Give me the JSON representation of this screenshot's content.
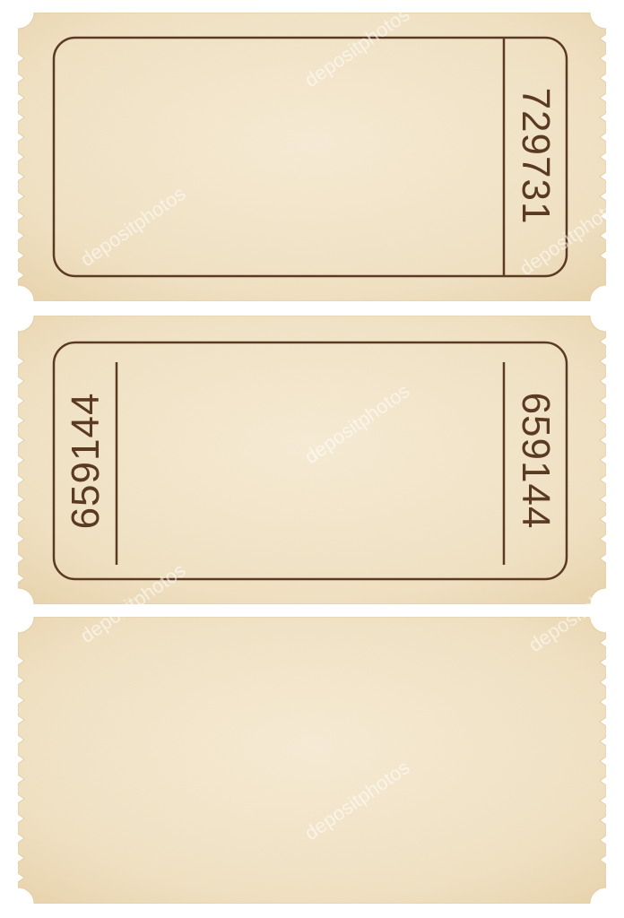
{
  "tickets": [
    {
      "type": "single-stub",
      "serial": "729731"
    },
    {
      "type": "double-stub",
      "serial_left": "659144",
      "serial_right": "659144"
    },
    {
      "type": "blank"
    }
  ],
  "colors": {
    "paper": "#f3e6cc",
    "paper_edge": "#e9d6b2",
    "ink": "#5a3a22",
    "background": "#ffffff"
  },
  "watermark": {
    "text": "depositphotos"
  }
}
